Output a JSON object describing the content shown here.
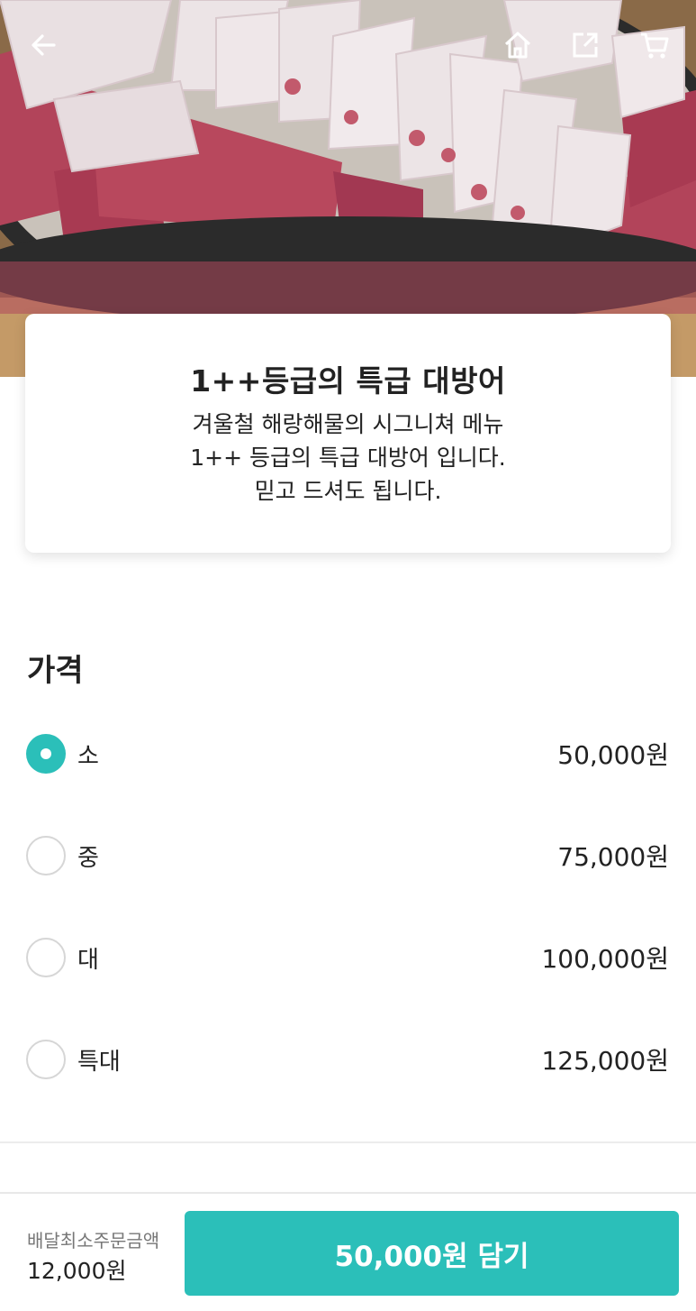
{
  "header": {
    "icons": [
      "back-arrow-icon",
      "home-icon",
      "share-icon",
      "cart-icon"
    ]
  },
  "menu": {
    "title": "1++등급의 특급 대방어",
    "description": [
      "겨울철 해랑해물의 시그니쳐 메뉴",
      "1++ 등급의 특급 대방어 입니다.",
      "믿고 드셔도 됩니다."
    ]
  },
  "price_section": {
    "title": "가격",
    "options": [
      {
        "label": "소",
        "price": "50,000원",
        "selected": true
      },
      {
        "label": "중",
        "price": "75,000원",
        "selected": false
      },
      {
        "label": "대",
        "price": "100,000원",
        "selected": false
      },
      {
        "label": "특대",
        "price": "125,000원",
        "selected": false
      }
    ]
  },
  "bottom_bar": {
    "min_order_label": "배달최소주문금액",
    "min_order_value": "12,000원",
    "add_button_label": "50,000원 담기"
  },
  "colors": {
    "accent": "#2bbfb9",
    "radio_border": "#d6d6d6",
    "text": "#222222",
    "muted_text": "#777777"
  }
}
